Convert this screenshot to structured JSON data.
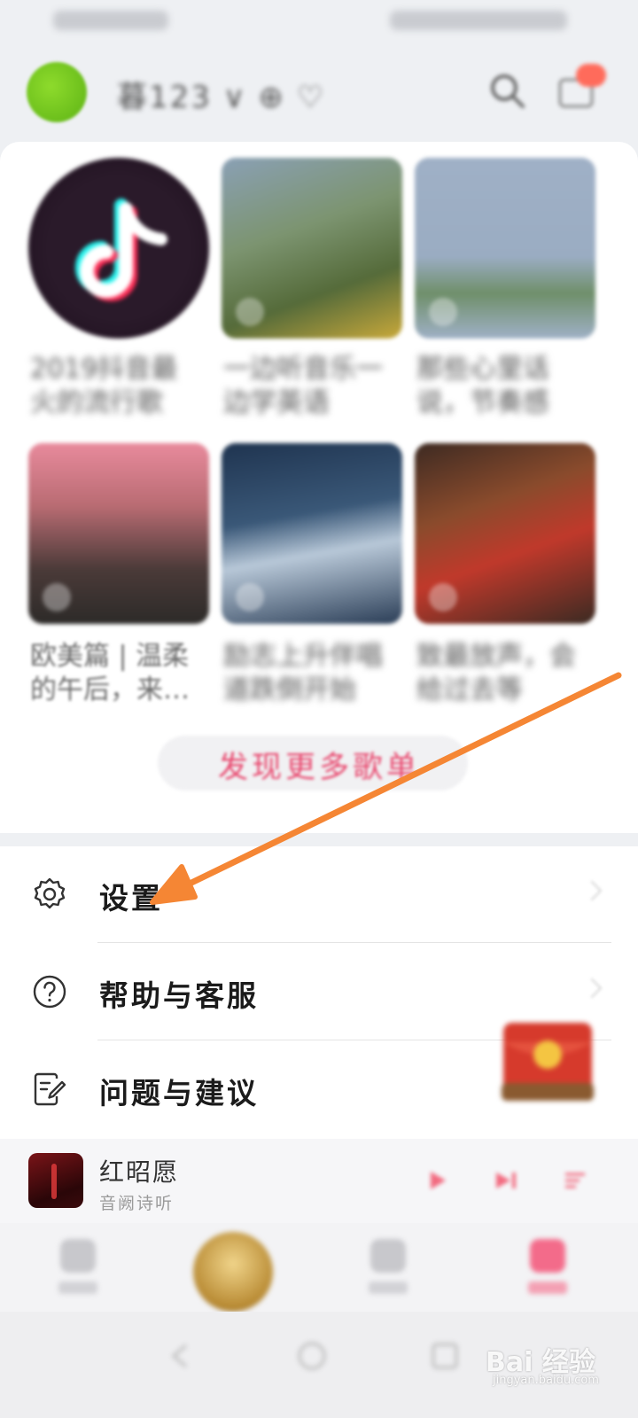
{
  "header": {
    "username": "暮123 ∨ ⊕ ♡"
  },
  "playlists": [
    {
      "title": "2019抖音最\n火的流行歌"
    },
    {
      "title": "一边听音乐一\n边学英语"
    },
    {
      "title": "那些心里话\n说，节奏感"
    },
    {
      "title": "欧美篇 | 温柔\n的午后，来…"
    },
    {
      "title": "励志上升伴唱\n道跌倒开始"
    },
    {
      "title": "致最放声，会\n给过去等"
    }
  ],
  "discover": {
    "label": "发现更多歌单"
  },
  "menu": {
    "items": [
      {
        "label": "设置",
        "icon": "gear-icon"
      },
      {
        "label": "帮助与客服",
        "icon": "help-circle-icon"
      },
      {
        "label": "问题与建议",
        "icon": "feedback-icon"
      }
    ]
  },
  "player": {
    "title": "红昭愿",
    "artist": "音阙诗听"
  },
  "watermark": {
    "main": "Bai 经验",
    "sub": "jingyan.baidu.com"
  },
  "colors": {
    "accent": "#e8496f",
    "arrow": "#f58634"
  }
}
